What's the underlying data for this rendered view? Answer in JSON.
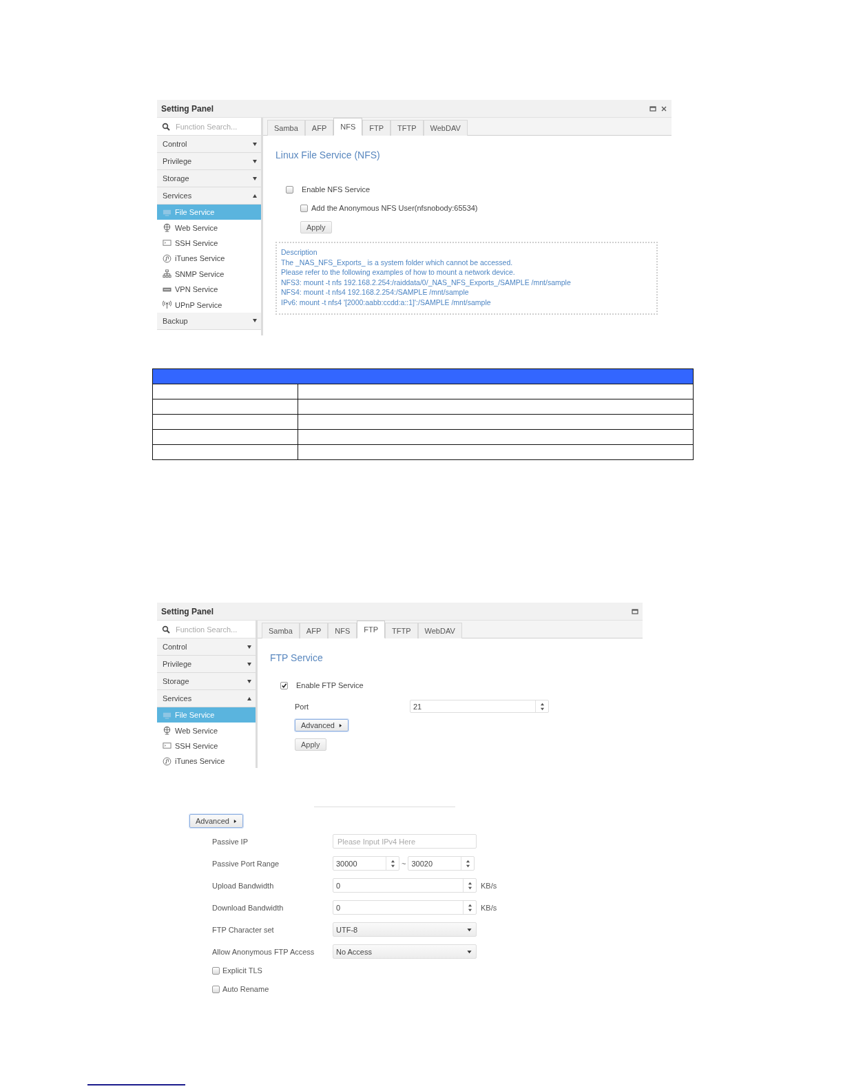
{
  "panels": [
    {
      "title": "Setting Panel",
      "closable": true,
      "search": {
        "placeholder": "Function Search..."
      },
      "sidebar": [
        {
          "label": "Control",
          "expanded": false
        },
        {
          "label": "Privilege",
          "expanded": false
        },
        {
          "label": "Storage",
          "expanded": false
        },
        {
          "label": "Services",
          "expanded": true,
          "children": [
            {
              "label": "File Service",
              "kind": "monitor",
              "selected": true
            },
            {
              "label": "Web Service",
              "kind": "globe",
              "selected": false
            },
            {
              "label": "SSH Service",
              "kind": "terminal",
              "selected": false
            },
            {
              "label": "iTunes Service",
              "kind": "music",
              "selected": false
            },
            {
              "label": "SNMP Service",
              "kind": "network",
              "selected": false
            },
            {
              "label": "VPN Service",
              "kind": "vpn",
              "selected": false
            },
            {
              "label": "UPnP Service",
              "kind": "antenna",
              "selected": false
            }
          ]
        },
        {
          "label": "Backup",
          "expanded": false
        }
      ],
      "tabs": [
        {
          "label": "Samba",
          "selected": false
        },
        {
          "label": "AFP",
          "selected": false
        },
        {
          "label": "NFS",
          "selected": true
        },
        {
          "label": "FTP",
          "selected": false
        },
        {
          "label": "TFTP",
          "selected": false
        },
        {
          "label": "WebDAV",
          "selected": false
        }
      ],
      "heading": "Linux File Service (NFS)",
      "content": [
        {
          "kind": "checkbox",
          "label": "Enable NFS Service",
          "checked": false
        },
        {
          "kind": "sub-checkbox",
          "label": "Add the Anonymous NFS User(nfsnobody:65534)",
          "checked": false
        },
        {
          "kind": "button",
          "label": "Apply"
        },
        {
          "kind": "description",
          "lines": [
            "Description",
            "The _NAS_NFS_Exports_ is a system folder which cannot be accessed.",
            "Please refer to the following examples of how to mount a network device.",
            "NFS3: mount -t nfs 192.168.2.254:/raiddata/0/_NAS_NFS_Exports_/SAMPLE /mnt/sample",
            "NFS4: mount -t nfs4 192.168.2.254:/SAMPLE /mnt/sample",
            "IPv6: mount -t nfs4 '[2000:aabb:ccdd:a::1]':/SAMPLE /mnt/sample"
          ]
        }
      ]
    },
    {
      "title": "Setting Panel",
      "closable": false,
      "search": {
        "placeholder": "Function Search..."
      },
      "sidebar": [
        {
          "label": "Control",
          "expanded": false
        },
        {
          "label": "Privilege",
          "expanded": false
        },
        {
          "label": "Storage",
          "expanded": false
        },
        {
          "label": "Services",
          "expanded": true,
          "children": [
            {
              "label": "File Service",
              "kind": "monitor",
              "selected": true
            },
            {
              "label": "Web Service",
              "kind": "globe",
              "selected": false
            },
            {
              "label": "SSH Service",
              "kind": "terminal",
              "selected": false
            },
            {
              "label": "iTunes Service",
              "kind": "music",
              "selected": false
            }
          ]
        }
      ],
      "tabs": [
        {
          "label": "Samba",
          "selected": false
        },
        {
          "label": "AFP",
          "selected": false
        },
        {
          "label": "NFS",
          "selected": false
        },
        {
          "label": "FTP",
          "selected": true
        },
        {
          "label": "TFTP",
          "selected": false
        },
        {
          "label": "WebDAV",
          "selected": false
        }
      ],
      "heading": "FTP Service",
      "content": [
        {
          "kind": "checkbox",
          "label": "Enable FTP Service",
          "checked": true
        },
        {
          "kind": "spinner-row",
          "label": "Port",
          "value": "21"
        },
        {
          "kind": "expander",
          "label": "Advanced"
        },
        {
          "kind": "button",
          "label": "Apply"
        }
      ]
    }
  ],
  "advanced": {
    "button": "Advanced",
    "rows": [
      {
        "kind": "text-field",
        "label": "Passive IP",
        "placeholder": "Please Input IPv4 Here"
      },
      {
        "kind": "range",
        "label": "Passive Port Range",
        "from": "30000",
        "separator": "~",
        "to": "30020"
      },
      {
        "kind": "spinner",
        "label": "Upload Bandwidth",
        "value": "0",
        "unit": "KB/s"
      },
      {
        "kind": "spinner",
        "label": "Download Bandwidth",
        "value": "0",
        "unit": "KB/s"
      },
      {
        "kind": "select",
        "label": "FTP Character set",
        "value": "UTF-8"
      },
      {
        "kind": "select",
        "label": "Allow Anonymous FTP Access",
        "value": "No Access"
      },
      {
        "kind": "checkbox",
        "label": "Explicit TLS",
        "checked": false
      },
      {
        "kind": "checkbox",
        "label": "Auto Rename",
        "checked": false
      }
    ]
  }
}
